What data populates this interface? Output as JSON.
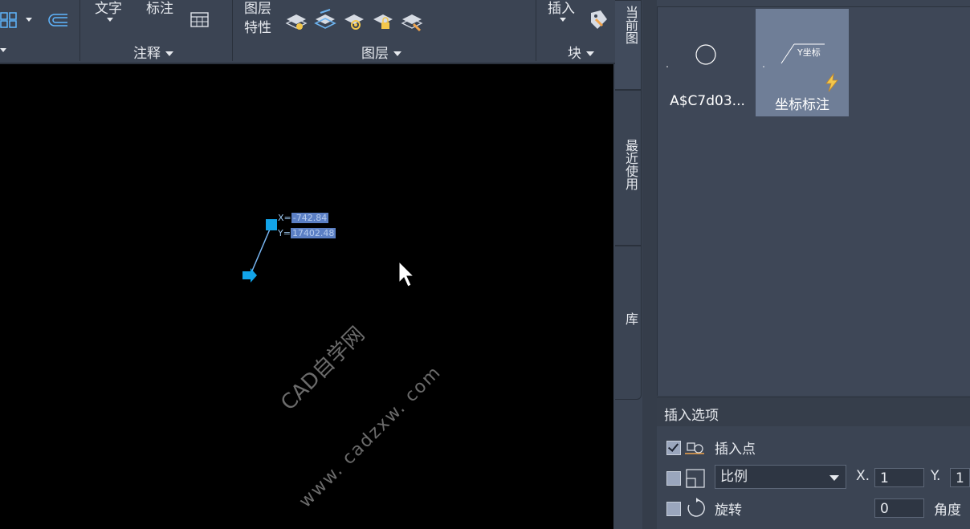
{
  "ribbon": {
    "text_label": "文字",
    "dim_label": "标注",
    "layer_props_line1": "图层",
    "layer_props_line2": "特性",
    "insert_label": "插入",
    "panels": {
      "annotation": "注释",
      "layers": "图层",
      "block": "块"
    }
  },
  "canvas": {
    "coord_x_prefix": "X=",
    "coord_x_value": "-742.84",
    "coord_y_prefix": "Y=",
    "coord_y_value": "17402.48",
    "watermark_line1": "CAD自学网",
    "watermark_line2": "www. cadzxw. com"
  },
  "side_tabs": {
    "current": "当前图",
    "recent": "最近使用",
    "library": "库"
  },
  "palette": {
    "blocks": [
      {
        "label": "A$C7d03..."
      },
      {
        "label": "坐标标注",
        "preview_text": "Y坐标"
      }
    ]
  },
  "insert_options": {
    "title": "插入选项",
    "insert_point": {
      "label": "插入点",
      "checked": true
    },
    "scale": {
      "selected": "比例",
      "checked": false,
      "x_label": "X.",
      "x_value": "1",
      "y_label": "Y.",
      "y_value": "1"
    },
    "rotate": {
      "label": "旋转",
      "checked": false,
      "angle_value": "0",
      "angle_label": "角度"
    }
  },
  "colors": {
    "ribbon_bg": "#3b4453",
    "canvas_bg": "#000000",
    "grip_blue": "#12a3e8",
    "selected_thumb": "#6f7e97"
  }
}
